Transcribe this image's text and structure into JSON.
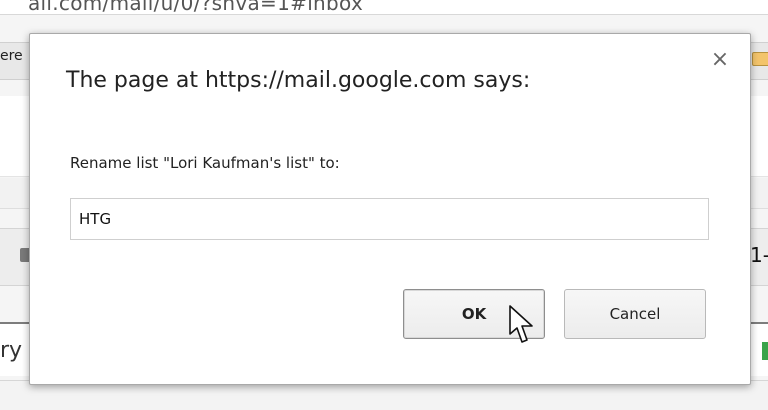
{
  "background": {
    "url_text": "ail.com/mail/u/0/?shva=1#inbox",
    "tab_fragment": "ere",
    "row_text": "1-",
    "lower_text": "ry"
  },
  "dialog": {
    "title": "The page at https://mail.google.com says:",
    "close_icon": "×",
    "prompt_label": "Rename list \"Lori Kaufman's list\" to:",
    "input_value": "HTG",
    "ok_label": "OK",
    "cancel_label": "Cancel"
  }
}
